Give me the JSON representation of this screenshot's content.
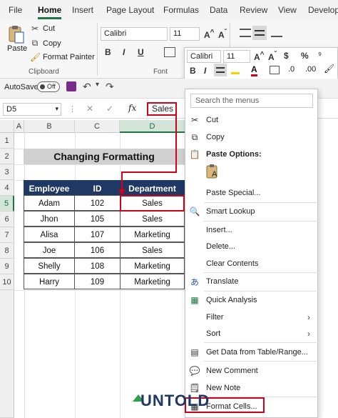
{
  "tabs": [
    "File",
    "Home",
    "Insert",
    "Page Layout",
    "Formulas",
    "Data",
    "Review",
    "View",
    "Develop"
  ],
  "active_tab": "Home",
  "clipboard": {
    "paste_label": "Paste",
    "cut_label": "Cut",
    "copy_label": "Copy",
    "format_painter_label": "Format Painter",
    "group_label": "Clipboard"
  },
  "font": {
    "name": "Calibri",
    "size": "11",
    "group_label": "Font"
  },
  "mini_toolbar": {
    "font_name": "Calibri",
    "font_size": "11",
    "currency_symbol": "$",
    "percent_symbol": "%"
  },
  "qat": {
    "autosave_label": "AutoSave",
    "toggle_label": "Off"
  },
  "formula_bar": {
    "name_box": "D5",
    "fx_label": "fx",
    "value": "Sales"
  },
  "columns": [
    "A",
    "B",
    "C",
    "D"
  ],
  "rows": [
    "1",
    "2",
    "3",
    "4",
    "5",
    "6",
    "7",
    "8",
    "9",
    "10"
  ],
  "sheet": {
    "title": "Changing Formatting",
    "headers": [
      "Employee",
      "ID",
      "Department"
    ],
    "records": [
      [
        "Adam",
        "102",
        "Sales"
      ],
      [
        "Jhon",
        "105",
        "Sales"
      ],
      [
        "Alisa",
        "107",
        "Marketing"
      ],
      [
        "Joe",
        "106",
        "Sales"
      ],
      [
        "Shelly",
        "108",
        "Marketing"
      ],
      [
        "Harry",
        "109",
        "Marketing"
      ]
    ]
  },
  "context_menu": {
    "search_placeholder": "Search the menus",
    "items": {
      "cut": "Cut",
      "copy": "Copy",
      "paste_options": "Paste Options:",
      "paste_special": "Paste Special...",
      "smart_lookup": "Smart Lookup",
      "insert": "Insert...",
      "delete": "Delete...",
      "clear_contents": "Clear Contents",
      "translate": "Translate",
      "quick_analysis": "Quick Analysis",
      "filter": "Filter",
      "sort": "Sort",
      "get_data": "Get Data from Table/Range...",
      "new_comment": "New Comment",
      "new_note": "New Note",
      "format_cells": "Format Cells..."
    }
  },
  "watermark": "UNTOLD",
  "colors": {
    "accent_green": "#217346",
    "header_navy": "#1f3864",
    "annotation_red": "#d0021b"
  }
}
